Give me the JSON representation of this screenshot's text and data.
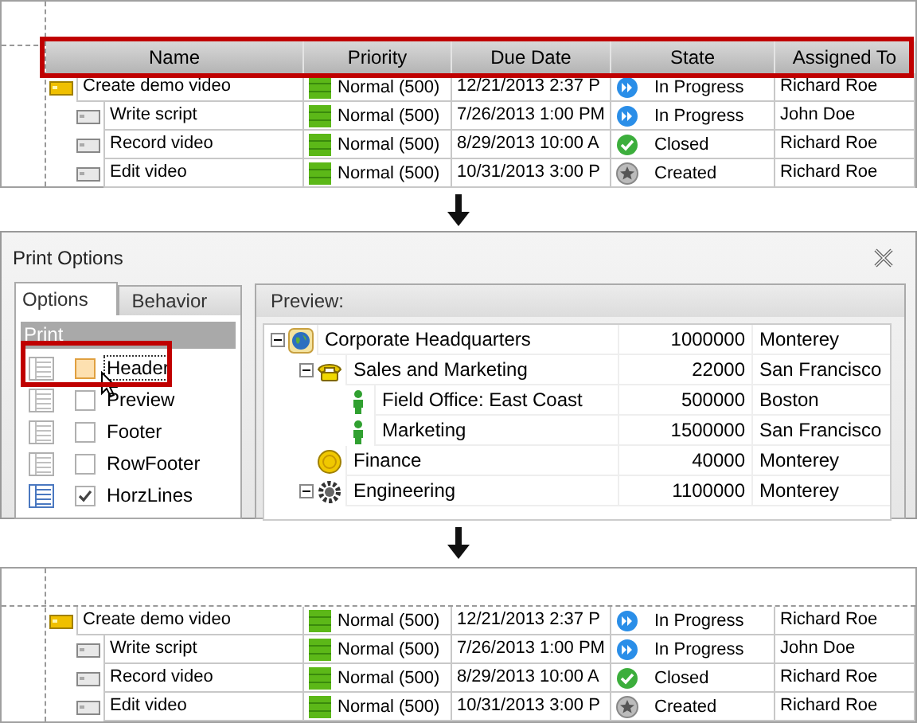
{
  "before_grid": {
    "header_highlighted": true,
    "columns": [
      "Name",
      "Priority",
      "Due Date",
      "State",
      "Assigned To"
    ],
    "rows": [
      {
        "name": "Create demo video",
        "kind": "folder",
        "priority": "Normal (500)",
        "due_date": "12/21/2013 2:37 P",
        "state": {
          "text": "In Progress",
          "kind": "in_progress"
        },
        "assigned_to": "Richard Roe",
        "children": [
          {
            "name": "Write script",
            "kind": "task",
            "priority": "Normal (500)",
            "due_date": "7/26/2013 1:00 PM",
            "state": {
              "text": "In Progress",
              "kind": "in_progress"
            },
            "assigned_to": "John Doe"
          },
          {
            "name": "Record video",
            "kind": "task",
            "priority": "Normal (500)",
            "due_date": "8/29/2013 10:00 A",
            "state": {
              "text": "Closed",
              "kind": "closed"
            },
            "assigned_to": "Richard Roe"
          },
          {
            "name": "Edit video",
            "kind": "task",
            "priority": "Normal (500)",
            "due_date": "10/31/2013 3:00 P",
            "state": {
              "text": "Created",
              "kind": "created"
            },
            "assigned_to": "Richard Roe"
          }
        ]
      }
    ]
  },
  "print_options": {
    "title": "Print Options",
    "tabs": [
      {
        "label": "Options",
        "selected": true
      },
      {
        "label": "Behavior",
        "selected": false
      }
    ],
    "group": "Print",
    "options": [
      {
        "label": "Header",
        "checked": false,
        "focused": true,
        "highlighted": true
      },
      {
        "label": "Preview",
        "checked": false,
        "focused": false,
        "highlighted": false
      },
      {
        "label": "Footer",
        "checked": false,
        "focused": false,
        "highlighted": false
      },
      {
        "label": "RowFooter",
        "checked": false,
        "focused": false,
        "highlighted": false
      },
      {
        "label": "HorzLines",
        "checked": true,
        "focused": false,
        "highlighted": false
      }
    ],
    "preview_label": "Preview:",
    "tree": [
      {
        "name": "Corporate Headquarters",
        "kind": "hq",
        "value": "1000000",
        "city": "Monterey",
        "expanded": true,
        "children": [
          {
            "name": "Sales and Marketing",
            "kind": "sales",
            "value": "22000",
            "city": "San Francisco",
            "expanded": true,
            "children": [
              {
                "name": "Field Office: East Coast",
                "kind": "staff",
                "value": "500000",
                "city": "Boston",
                "expanded": false
              },
              {
                "name": "Marketing",
                "kind": "staff",
                "value": "1500000",
                "city": "San Francisco",
                "expanded": false
              }
            ]
          },
          {
            "name": "Finance",
            "kind": "finance",
            "value": "40000",
            "city": "Monterey",
            "expanded": false
          },
          {
            "name": "Engineering",
            "kind": "engineering",
            "value": "1100000",
            "city": "Monterey",
            "expanded": true
          }
        ]
      }
    ]
  },
  "after_grid": {
    "rows": [
      {
        "name": "Create demo video",
        "kind": "folder",
        "priority": "Normal (500)",
        "due_date": "12/21/2013 2:37 P",
        "state": {
          "text": "In Progress",
          "kind": "in_progress"
        },
        "assigned_to": "Richard Roe",
        "children": [
          {
            "name": "Write script",
            "kind": "task",
            "priority": "Normal (500)",
            "due_date": "7/26/2013 1:00 PM",
            "state": {
              "text": "In Progress",
              "kind": "in_progress"
            },
            "assigned_to": "John Doe"
          },
          {
            "name": "Record video",
            "kind": "task",
            "priority": "Normal (500)",
            "due_date": "8/29/2013 10:00 A",
            "state": {
              "text": "Closed",
              "kind": "closed"
            },
            "assigned_to": "Richard Roe"
          },
          {
            "name": "Edit video",
            "kind": "task",
            "priority": "Normal (500)",
            "due_date": "10/31/2013 3:00 P",
            "state": {
              "text": "Created",
              "kind": "created"
            },
            "assigned_to": "Richard Roe"
          }
        ]
      }
    ]
  }
}
